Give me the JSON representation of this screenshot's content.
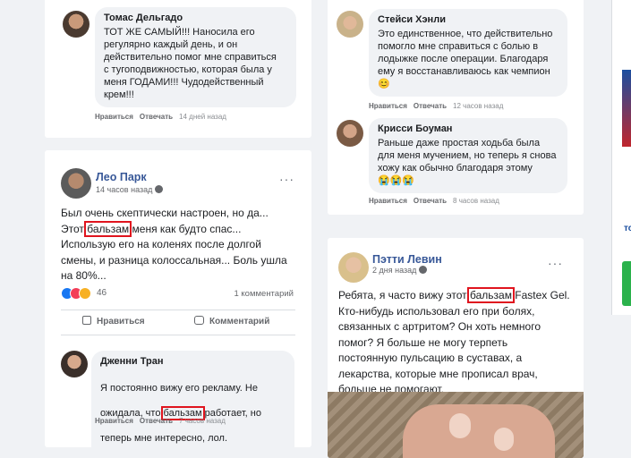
{
  "left": {
    "top_comment": {
      "name": "Томас Дельгадо",
      "text": "ТОТ ЖЕ САМЫЙ!!! Наносила его\nрегулярно каждый день, и он\nдействительно помог мне справиться\nс тугоподвижностью, которая была у\nменя ГОДАМИ!!! Чудодейственный\nкрем!!!",
      "like": "Нравиться",
      "reply": "Отвечать",
      "time": "14 дней назад"
    },
    "post": {
      "author": "Лео Парк",
      "time": "14 часов назад",
      "text_pre1": "Был очень скептически настроен, но да...",
      "text_pre2": "Этот ",
      "highlight": "бальзам",
      "text_post2": " меня как будто спас...",
      "text_line3": "Использую его на коленях после долгой",
      "text_line4": "смены, и разница колоссальная... Боль ушла",
      "text_line5": "на 80%...",
      "reactions_count": "46",
      "comments_count": "1 комментарий",
      "like_button": "Нравиться",
      "comment_button": "Комментарий"
    },
    "reply": {
      "name": "Дженни Тран",
      "text_line1": "Я постоянно вижу его рекламу. Не",
      "text_pre2": "ожидала, что ",
      "highlight": "бальзам",
      "text_post2": " работает, но",
      "text_line3": "теперь мне интересно, лол.",
      "like": "Нравиться",
      "reply": "Отвечать",
      "time": "7 часов назад"
    }
  },
  "middle": {
    "comment1": {
      "name": "Стейси Хэнли",
      "text": "Это единственное, что действительно\nпомогло мне справиться с болью в\nлодыжке после операции. Благодаря\nему я восстанавливаюсь как чемпион",
      "emoji": "😊",
      "like": "Нравиться",
      "reply": "Отвечать",
      "time": "12 часов назад"
    },
    "comment2": {
      "name": "Крисси Боуман",
      "text": "Раньше даже простая ходьба была\nдля меня мучением, но теперь я снова\nхожу как обычно благодаря этому",
      "emoji": "😭😭😭",
      "like": "Нравиться",
      "reply": "Отвечать",
      "time": "8 часов назад"
    },
    "post": {
      "author": "Пэтти Левин",
      "time": "2 дня назад",
      "text_pre1": "Ребята, я часто вижу этот ",
      "highlight": "бальзам",
      "text_post1": " Fastex Gel.",
      "text_line2": "Кто-нибудь использовал его при болях,",
      "text_line3": "связанных с артритом? Он хоть немного",
      "text_line4": "помог? Я больше не могу терпеть",
      "text_line5": "постоянную пульсацию в суставах, а",
      "text_line6": "лекарства, которые мне прописал врач,",
      "text_line7": "больше не помогают."
    }
  },
  "right": {
    "fragment": "тс"
  },
  "colors": {
    "highlight": "#e0141e",
    "link": "#385898"
  }
}
